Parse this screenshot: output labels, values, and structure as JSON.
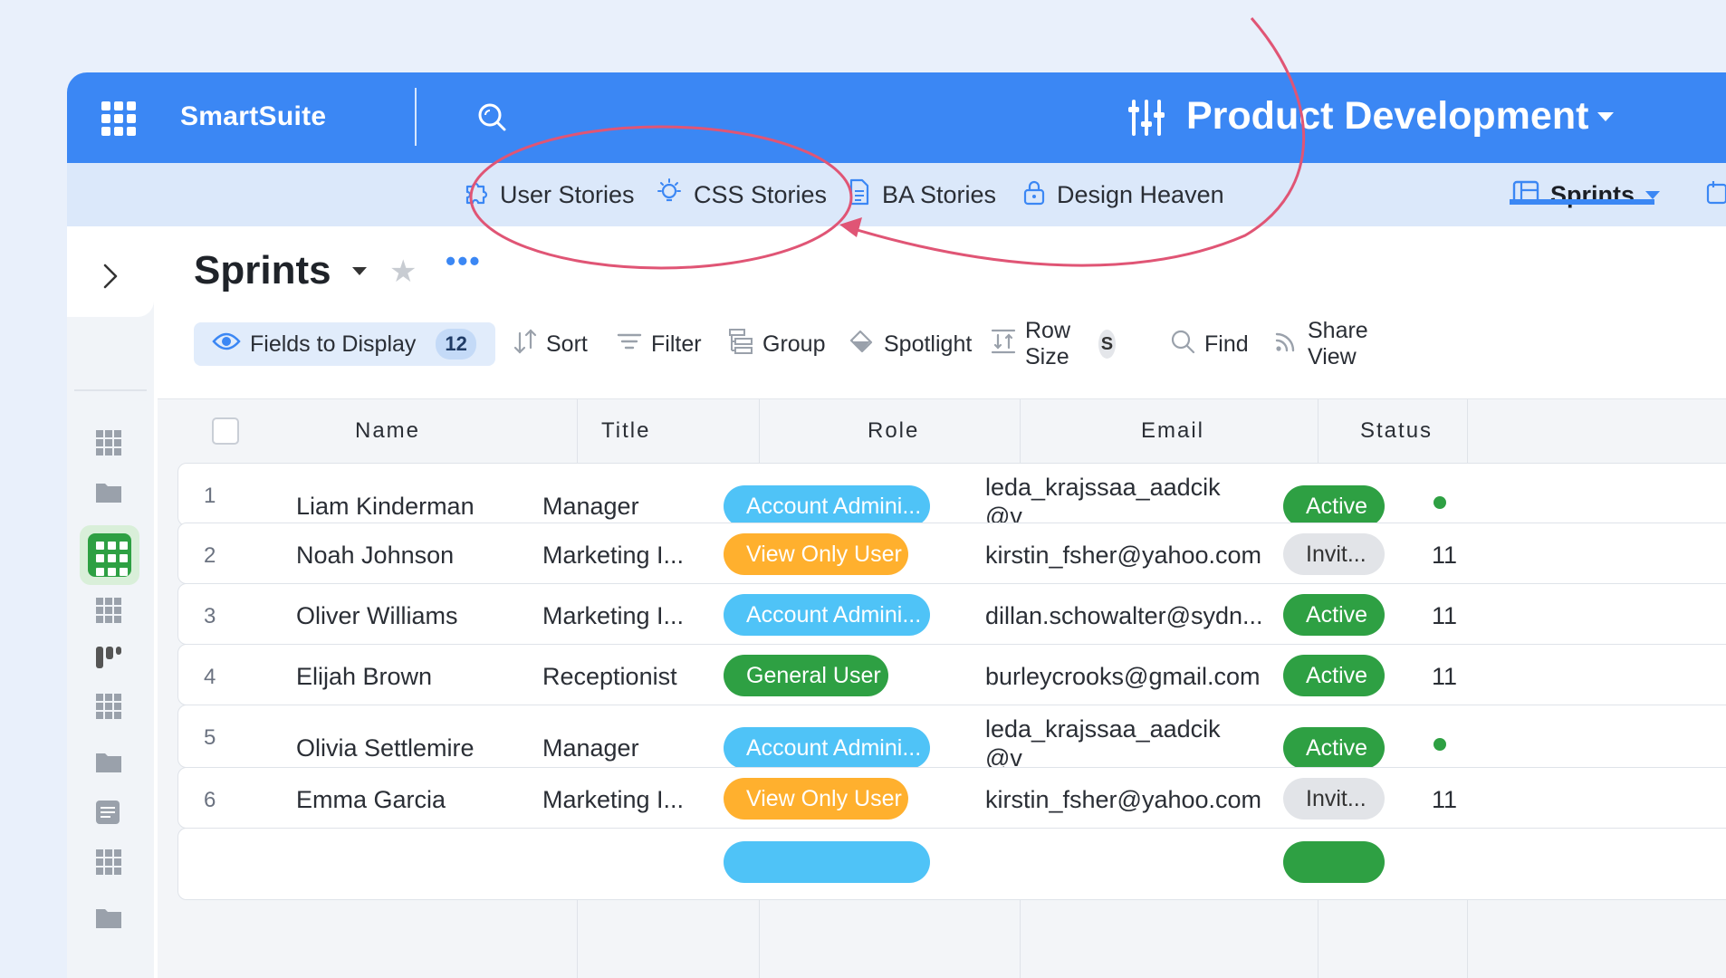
{
  "app": {
    "brand": "SmartSuite",
    "solution_title": "Product Development"
  },
  "colors": {
    "accent": "#3b87f4",
    "green": "#2ea043",
    "cyan": "#4fc3f7",
    "orange": "#ffb02e",
    "annotation": "#e05575"
  },
  "tabs": [
    {
      "label": "User Stories",
      "icon": "puzzle-icon"
    },
    {
      "label": "CSS Stories",
      "icon": "lightbulb-icon"
    },
    {
      "label": "BA Stories",
      "icon": "document-icon"
    },
    {
      "label": "Design Heaven",
      "icon": "lock-icon"
    },
    {
      "label": "Sprints",
      "icon": "board-icon",
      "active": true
    }
  ],
  "page": {
    "title": "Sprints"
  },
  "toolbar": {
    "fields_label": "Fields to Display",
    "fields_count": "12",
    "sort": "Sort",
    "filter": "Filter",
    "group": "Group",
    "spotlight": "Spotlight",
    "row_size": "Row Size",
    "row_size_value": "S",
    "find": "Find",
    "share": "Share View"
  },
  "table": {
    "headers": [
      "Name",
      "Title",
      "Role",
      "Email",
      "Status"
    ],
    "rows": [
      {
        "num": "1",
        "name": "Liam Kinderman",
        "title": "Manager",
        "role": "Account Admini...",
        "role_color": "cyan",
        "email": "leda_krajssaa_aadcik",
        "email2": "@v",
        "status": "Active",
        "extra": ""
      },
      {
        "num": "2",
        "name": "Noah Johnson",
        "title": "Marketing I...",
        "role": "View Only User",
        "role_color": "orange",
        "email": "kirstin_fsher@yahoo.com",
        "email2": "",
        "status": "Invit...",
        "extra": "11"
      },
      {
        "num": "3",
        "name": "Oliver Williams",
        "title": "Marketing I...",
        "role": "Account Admini...",
        "role_color": "cyan",
        "email": "dillan.schowalter@sydn...",
        "email2": "",
        "status": "Active",
        "extra": "11"
      },
      {
        "num": "4",
        "name": "Elijah Brown",
        "title": "Receptionist",
        "role": "General User",
        "role_color": "green",
        "email": "burleycrooks@gmail.com",
        "email2": "",
        "status": "Active",
        "extra": "11"
      },
      {
        "num": "5",
        "name": "Olivia Settlemire",
        "title": "Manager",
        "role": "Account Admini...",
        "role_color": "cyan",
        "email": "leda_krajssaa_aadcik",
        "email2": "@v",
        "status": "Active",
        "extra": ""
      },
      {
        "num": "6",
        "name": "Emma Garcia",
        "title": "Marketing I...",
        "role": "View Only User",
        "role_color": "orange",
        "email": "kirstin_fsher@yahoo.com",
        "email2": "",
        "status": "Invit...",
        "extra": "11"
      }
    ]
  }
}
